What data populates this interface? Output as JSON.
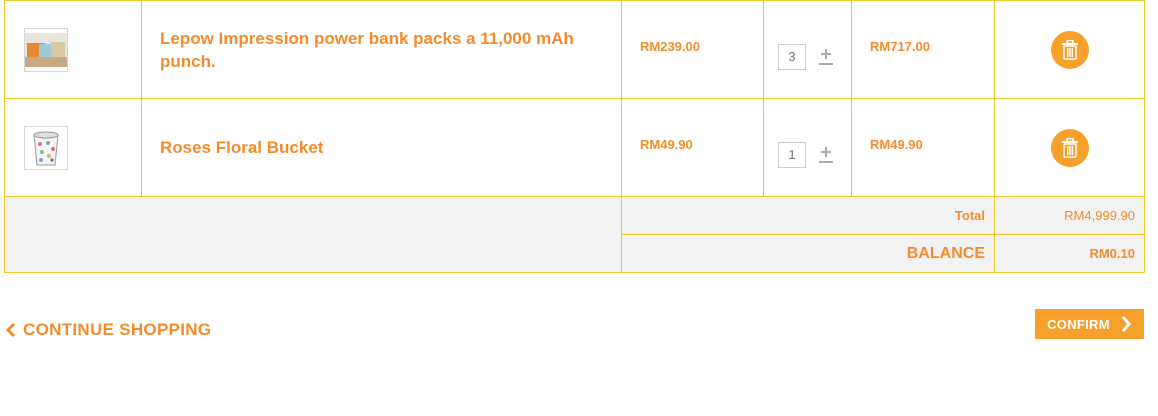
{
  "items": [
    {
      "name": "Lepow Impression power bank packs a 11,000 mAh punch.",
      "unit_price": "RM239.00",
      "quantity": "3",
      "subtotal": "RM717.00",
      "thumbnail_icon": "power-bank-thumbnail"
    },
    {
      "name": "Roses Floral Bucket",
      "unit_price": "RM49.90",
      "quantity": "1",
      "subtotal": "RM49.90",
      "thumbnail_icon": "floral-bucket-thumbnail"
    }
  ],
  "summary": {
    "total_label": "Total",
    "total_value": "RM4,999.90",
    "balance_label": "BALANCE",
    "balance_value": "RM0.10"
  },
  "actions": {
    "continue_label": "CONTINUE SHOPPING",
    "confirm_label": "CONFIRM"
  },
  "colors": {
    "accent": "#f68b2b",
    "button": "#f7a12c",
    "border": "#f3c72a",
    "footer_bg": "#f1f1f1"
  }
}
